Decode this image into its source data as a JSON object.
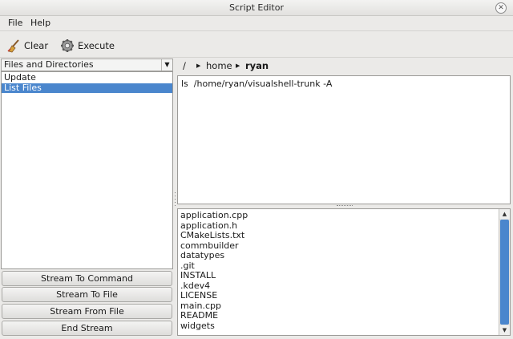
{
  "window": {
    "title": "Script Editor",
    "close_icon": "close-icon"
  },
  "menu": {
    "items": [
      "File",
      "Help"
    ]
  },
  "toolbar": {
    "clear_label": "Clear",
    "clear_icon": "broom-icon",
    "execute_label": "Execute",
    "execute_icon": "gear-icon"
  },
  "sidebar": {
    "combo_value": "Files and Directories",
    "items": [
      {
        "label": "Update",
        "selected": false
      },
      {
        "label": "List Files",
        "selected": true
      }
    ],
    "buttons": [
      "Stream To Command",
      "Stream To File",
      "Stream From File",
      "End Stream"
    ]
  },
  "breadcrumb": {
    "parts": [
      "/",
      "home",
      "ryan"
    ]
  },
  "editor": {
    "command": "ls  /home/ryan/visualshell-trunk -A"
  },
  "output": {
    "lines": [
      "application.cpp",
      "application.h",
      "CMakeLists.txt",
      "commbuilder",
      "datatypes",
      ".git",
      "INSTALL",
      ".kdev4",
      "LICENSE",
      "main.cpp",
      "README",
      "widgets"
    ]
  },
  "colors": {
    "selection": "#4a86cd",
    "window_bg": "#ebeae8"
  }
}
